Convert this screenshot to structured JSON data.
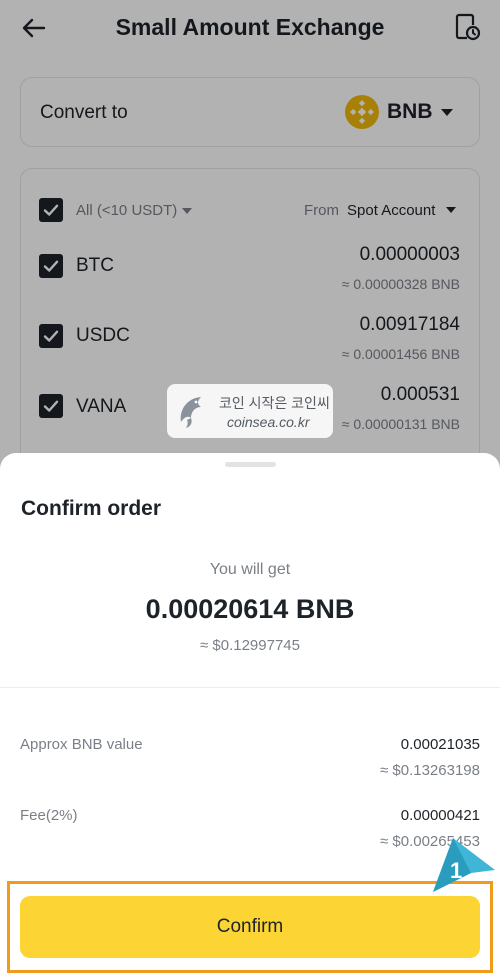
{
  "header": {
    "title": "Small Amount Exchange",
    "back_icon": "arrow-left-icon",
    "history_icon": "history-icon"
  },
  "convert": {
    "label": "Convert to",
    "coin": "BNB",
    "coin_icon": "bnb-icon"
  },
  "assets": {
    "all_label": "All (<10 USDT)",
    "from_label": "From",
    "account": "Spot Account",
    "items": [
      {
        "name": "BTC",
        "amount": "0.00000003",
        "approx": "≈ 0.00000328 BNB"
      },
      {
        "name": "USDC",
        "amount": "0.00917184",
        "approx": "≈ 0.00001456 BNB"
      },
      {
        "name": "VANA",
        "amount": "0.000531",
        "approx": "≈ 0.00000131 BNB"
      }
    ]
  },
  "watermark": {
    "korean": "코인 시작은 코인씨",
    "site": "coinsea.co.kr"
  },
  "sheet": {
    "title": "Confirm order",
    "you_will_get": "You will get",
    "amount": "0.00020614 BNB",
    "usd": "≈ $0.12997745",
    "approx_label": "Approx BNB value",
    "approx_value": "0.00021035",
    "approx_usd": "≈ $0.13263198",
    "fee_label": "Fee(2%)",
    "fee_value": "0.00000421",
    "fee_usd": "≈ $0.00265453",
    "confirm": "Confirm"
  },
  "annotation": {
    "step": "1",
    "highlight_color": "#f29a1c",
    "pointer_color": "#3fb6d6"
  },
  "colors": {
    "accent": "#fcd535",
    "bnb": "#f0b90b",
    "text": "#1e2329",
    "muted": "#7a7f87"
  }
}
